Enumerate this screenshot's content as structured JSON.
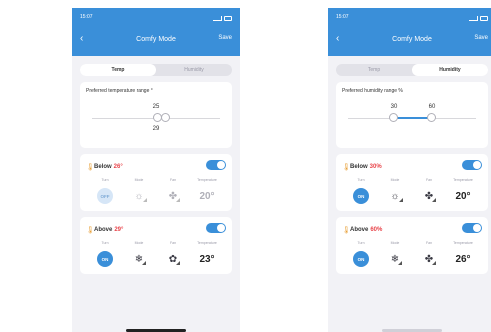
{
  "screens": [
    {
      "status_time": "15:07",
      "title": "Comfy Mode",
      "save": "Save",
      "tabs": [
        {
          "label": "Temp",
          "active": true
        },
        {
          "label": "Humidity",
          "active": false
        }
      ],
      "range_title": "Preferred temperature range °",
      "range_low": "25",
      "range_high": "29",
      "below": {
        "label": "Below",
        "value": "26°",
        "turn": "OFF",
        "temperature": "20°"
      },
      "above": {
        "label": "Above",
        "value": "29°",
        "turn": "ON",
        "temperature": "23°"
      }
    },
    {
      "status_time": "15:07",
      "title": "Comfy Mode",
      "save": "Save",
      "tabs": [
        {
          "label": "Temp",
          "active": false
        },
        {
          "label": "Humidity",
          "active": true
        }
      ],
      "range_title": "Preferred humidity range %",
      "range_low": "30",
      "range_high": "60",
      "below": {
        "label": "Below",
        "value": "30%",
        "turn": "ON",
        "temperature": "20°"
      },
      "above": {
        "label": "Above",
        "value": "60%",
        "turn": "ON",
        "temperature": "26°"
      }
    }
  ],
  "control_labels": {
    "turn": "Turn",
    "mode": "Mode",
    "fan": "Fan",
    "temperature": "Temperature"
  },
  "colors": {
    "accent": "#3a8fd9",
    "warning": "#e8444a"
  }
}
